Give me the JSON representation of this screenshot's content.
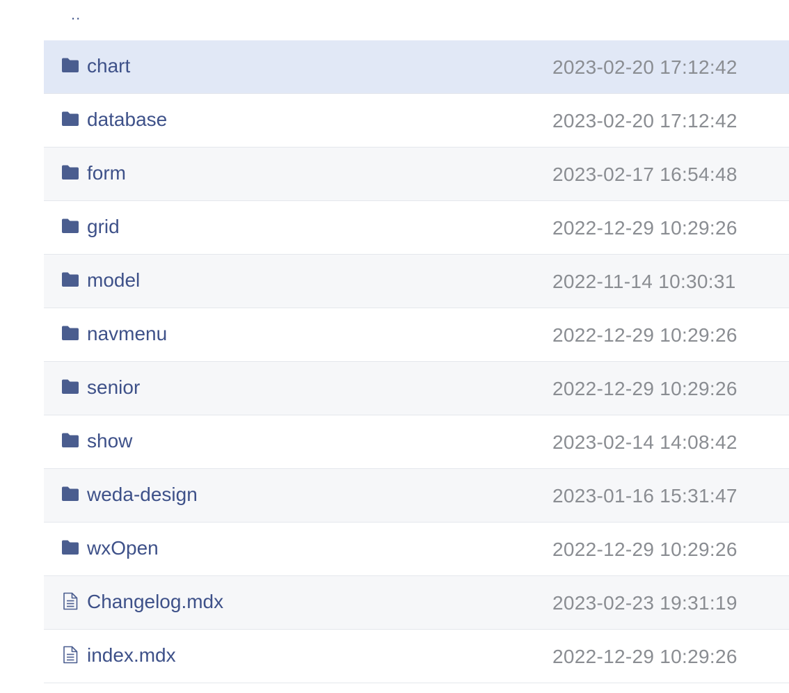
{
  "parent": {
    "label": ".."
  },
  "colors": {
    "link": "#3e5189",
    "icon": "#4a5d8f",
    "date": "#8a8d92",
    "selected_row": "#e1e8f6",
    "stripe_row": "#f6f7f9"
  },
  "entries": [
    {
      "type": "folder",
      "icon": "folder-icon",
      "name": "chart",
      "modified": "2023-02-20 17:12:42",
      "selected": true
    },
    {
      "type": "folder",
      "icon": "folder-icon",
      "name": "database",
      "modified": "2023-02-20 17:12:42"
    },
    {
      "type": "folder",
      "icon": "folder-icon",
      "name": "form",
      "modified": "2023-02-17 16:54:48"
    },
    {
      "type": "folder",
      "icon": "folder-icon",
      "name": "grid",
      "modified": "2022-12-29 10:29:26"
    },
    {
      "type": "folder",
      "icon": "folder-icon",
      "name": "model",
      "modified": "2022-11-14 10:30:31"
    },
    {
      "type": "folder",
      "icon": "folder-icon",
      "name": "navmenu",
      "modified": "2022-12-29 10:29:26"
    },
    {
      "type": "folder",
      "icon": "folder-icon",
      "name": "senior",
      "modified": "2022-12-29 10:29:26"
    },
    {
      "type": "folder",
      "icon": "folder-icon",
      "name": "show",
      "modified": "2023-02-14 14:08:42"
    },
    {
      "type": "folder",
      "icon": "folder-icon",
      "name": "weda-design",
      "modified": "2023-01-16 15:31:47"
    },
    {
      "type": "folder",
      "icon": "folder-icon",
      "name": "wxOpen",
      "modified": "2022-12-29 10:29:26"
    },
    {
      "type": "file",
      "icon": "file-text-icon",
      "name": "Changelog.mdx",
      "modified": "2023-02-23 19:31:19"
    },
    {
      "type": "file",
      "icon": "file-text-icon",
      "name": "index.mdx",
      "modified": "2022-12-29 10:29:26"
    }
  ]
}
